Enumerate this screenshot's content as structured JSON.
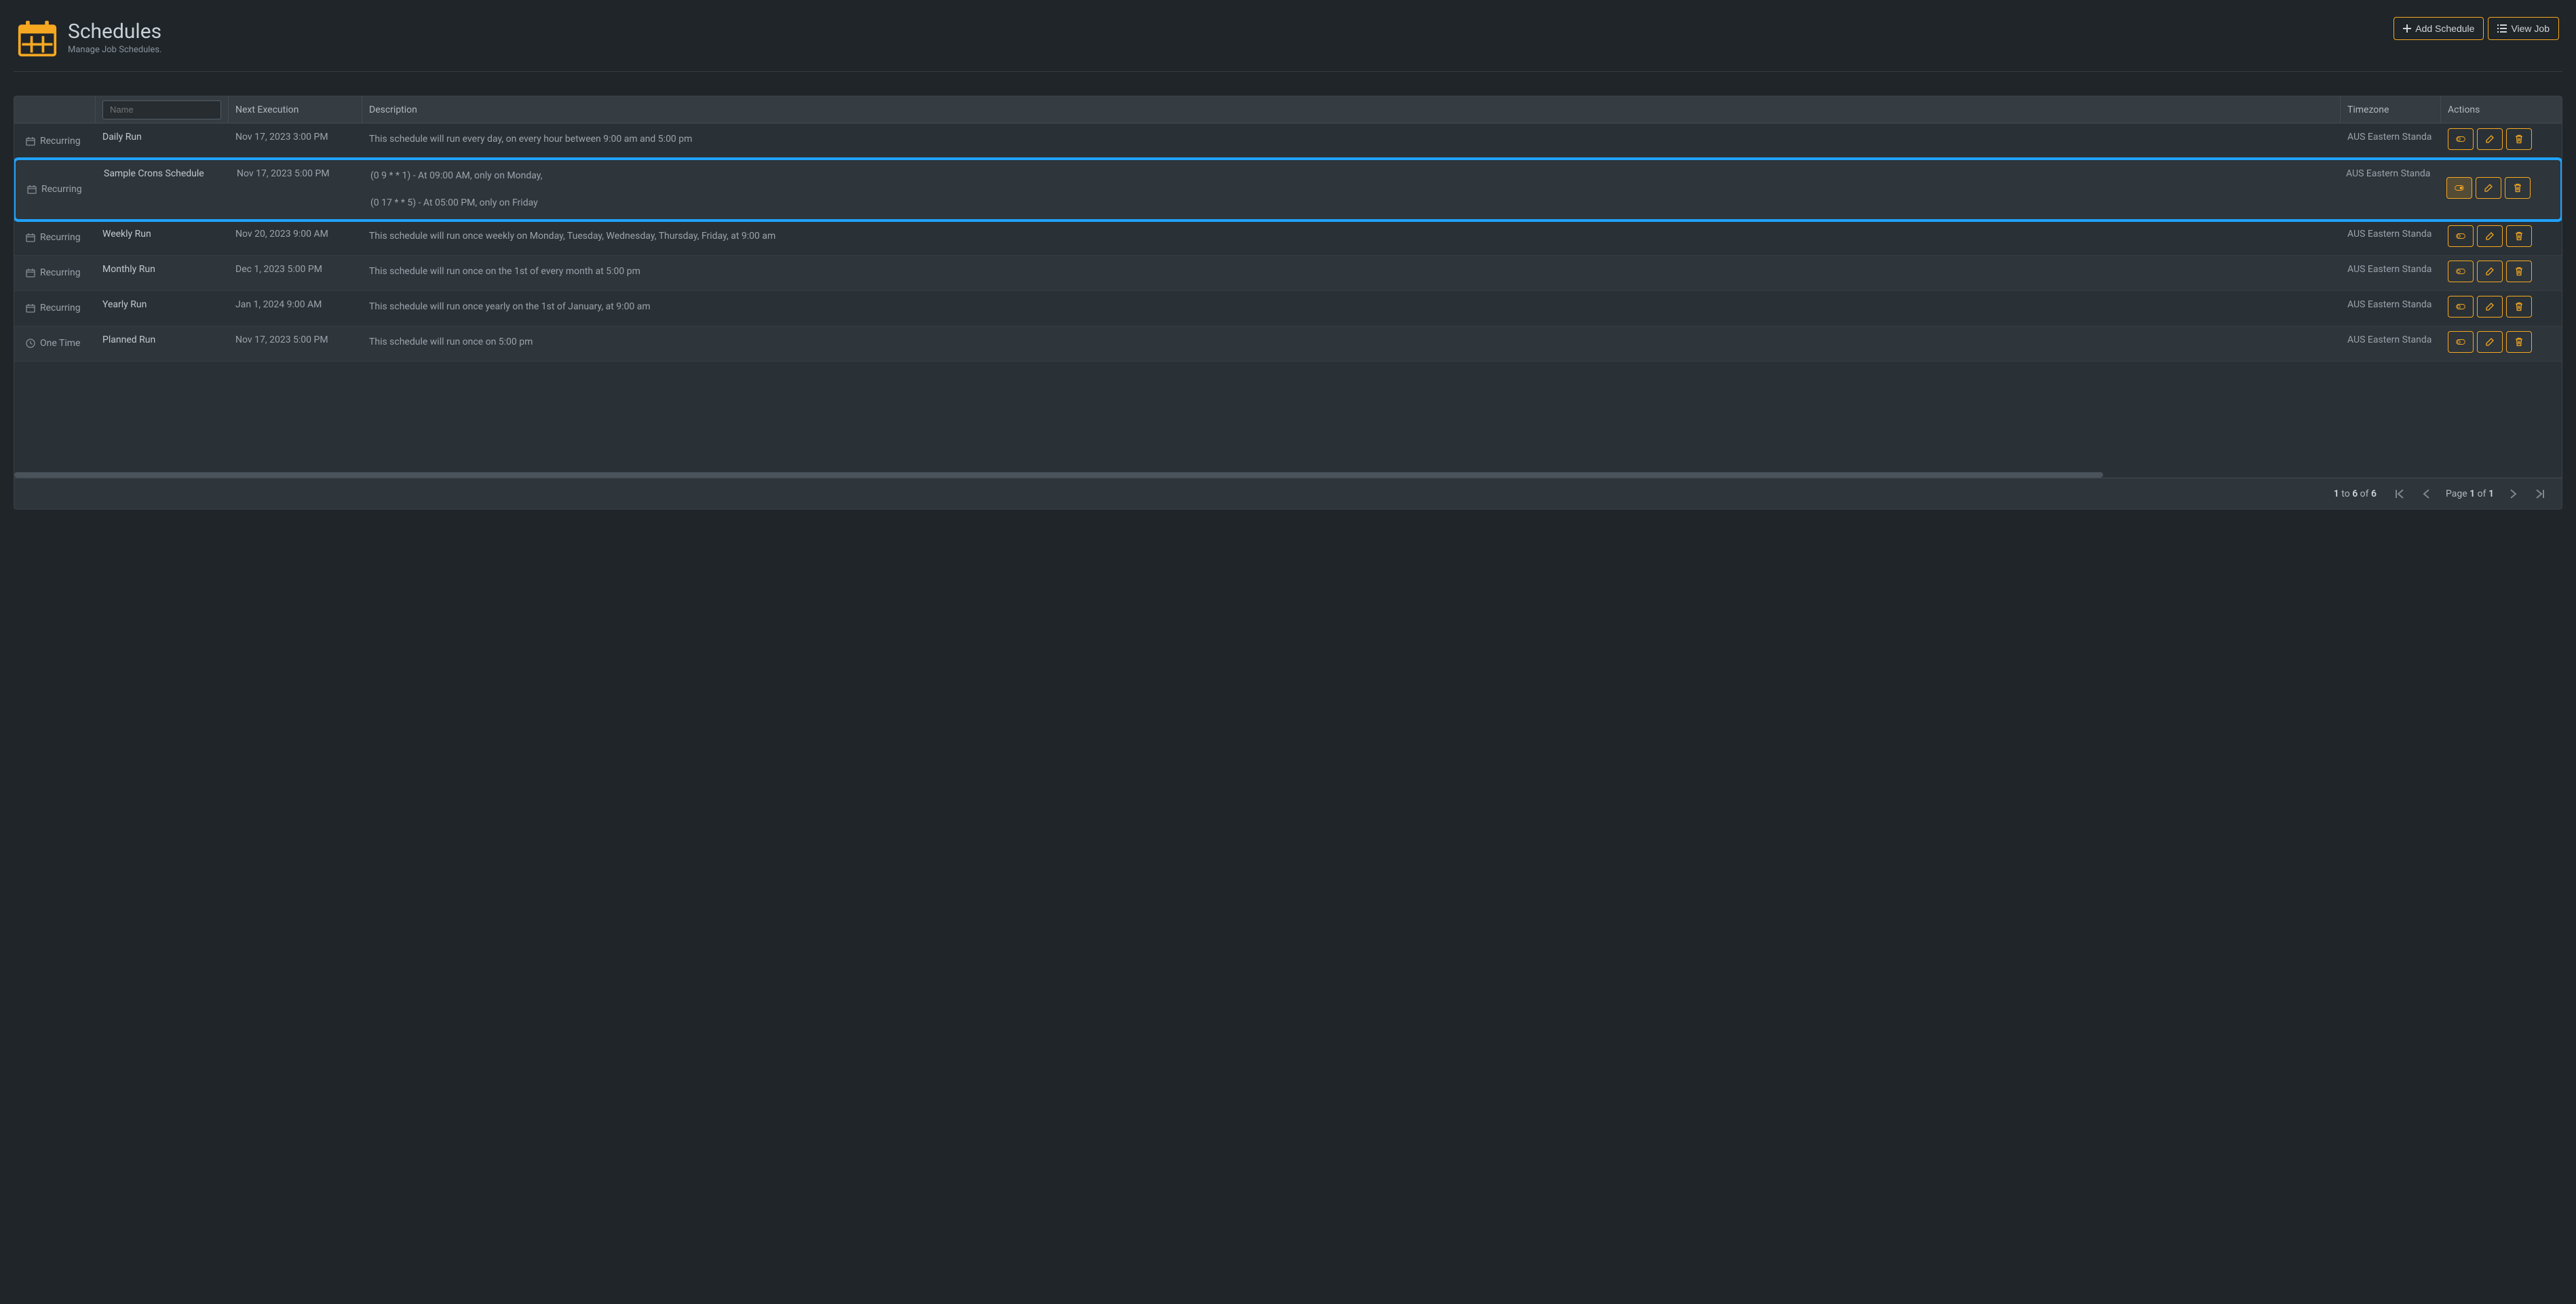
{
  "header": {
    "title": "Schedules",
    "subtitle": "Manage Job Schedules.",
    "add_label": "Add Schedule",
    "view_label": "View Job"
  },
  "columns": {
    "name_placeholder": "Name",
    "next": "Next Execution",
    "desc": "Description",
    "tz": "Timezone",
    "actions": "Actions"
  },
  "rows": [
    {
      "type_icon": "calendar",
      "type": "Recurring",
      "name": "Daily Run",
      "next": "Nov 17, 2023 3:00 PM",
      "desc": [
        "This schedule will run every day, on every hour between 9:00 am and 5:00 pm"
      ],
      "tz": "AUS Eastern Standa",
      "alt": false,
      "highlight": false,
      "toggle_active": false
    },
    {
      "type_icon": "calendar",
      "type": "Recurring",
      "name": "Sample Crons Schedule",
      "next": "Nov 17, 2023 5:00 PM",
      "desc": [
        "(0 9 * * 1) - At 09:00 AM, only on Monday,",
        "(0 17 * * 5) - At 05:00 PM, only on Friday"
      ],
      "tz": "AUS Eastern Standa",
      "alt": true,
      "highlight": true,
      "toggle_active": true
    },
    {
      "type_icon": "calendar",
      "type": "Recurring",
      "name": "Weekly Run",
      "next": "Nov 20, 2023 9:00 AM",
      "desc": [
        "This schedule will run once weekly on Monday, Tuesday, Wednesday, Thursday, Friday, at 9:00 am"
      ],
      "tz": "AUS Eastern Standa",
      "alt": false,
      "highlight": false,
      "toggle_active": false
    },
    {
      "type_icon": "calendar",
      "type": "Recurring",
      "name": "Monthly Run",
      "next": "Dec 1, 2023 5:00 PM",
      "desc": [
        "This schedule will run once on the 1st of every month at 5:00 pm"
      ],
      "tz": "AUS Eastern Standa",
      "alt": true,
      "highlight": false,
      "toggle_active": false
    },
    {
      "type_icon": "calendar",
      "type": "Recurring",
      "name": "Yearly Run",
      "next": "Jan 1, 2024 9:00 AM",
      "desc": [
        "This schedule will run once yearly on the 1st of January, at 9:00 am"
      ],
      "tz": "AUS Eastern Standa",
      "alt": false,
      "highlight": false,
      "toggle_active": false
    },
    {
      "type_icon": "clock",
      "type": "One Time",
      "name": "Planned Run",
      "next": "Nov 17, 2023 5:00 PM",
      "desc": [
        "This schedule will run once on 5:00 pm"
      ],
      "tz": "AUS Eastern Standa",
      "alt": true,
      "highlight": false,
      "toggle_active": false
    }
  ],
  "footer": {
    "range_from": "1",
    "range_word1": "to",
    "range_to": "6",
    "range_word2": "of",
    "range_total": "6",
    "page_label": "Page",
    "page_cur": "1",
    "page_word": "of",
    "page_total": "1"
  }
}
